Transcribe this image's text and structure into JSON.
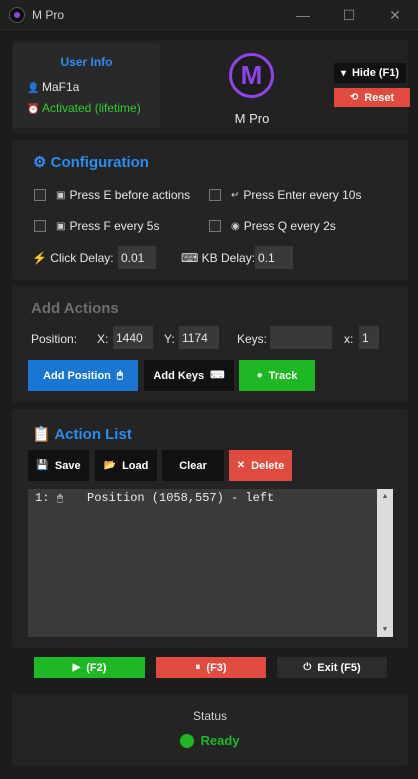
{
  "window": {
    "title": "M Pro",
    "minimize_glyph": "—",
    "maximize_glyph": "☐",
    "close_glyph": "✕"
  },
  "user_info": {
    "title": "User Info",
    "username": "MaF1a",
    "user_glyph": "👤",
    "status": "Activated (lifetime)",
    "status_glyph": "⏰",
    "status_color": "#2fcf2f"
  },
  "logo": {
    "letter": "M",
    "label": "M Pro",
    "color": "#8e44e8"
  },
  "header_buttons": {
    "hide_label": "Hide (F1)",
    "hide_glyph": "▾",
    "reset_label": "Reset",
    "reset_glyph": "⟲"
  },
  "configuration": {
    "title": "Configuration",
    "title_glyph": "⚙",
    "options": [
      {
        "label": "Press E before actions",
        "glyph": "▣",
        "checked": false
      },
      {
        "label": "Press Enter every 10s",
        "glyph": "↵",
        "checked": false
      },
      {
        "label": "Press F every 5s",
        "glyph": "▣",
        "checked": false
      },
      {
        "label": "Press Q every 2s",
        "glyph": "◉",
        "checked": false
      }
    ],
    "click_delay_label": "Click Delay:",
    "click_delay_glyph": "⚡",
    "click_delay_value": "0.01",
    "kb_delay_label": "KB Delay:",
    "kb_delay_glyph": "⌨",
    "kb_delay_value": "0.1"
  },
  "add_actions": {
    "title": "Add Actions",
    "position_label": "Position:",
    "x_label": "X:",
    "x_value": "1440",
    "y_label": "Y:",
    "y_value": "1174",
    "keys_label": "Keys:",
    "keys_value": "",
    "repeat_label": "x:",
    "repeat_value": "1",
    "add_position_label": "Add Position",
    "add_position_glyph": "🖱",
    "add_keys_label": "Add Keys",
    "add_keys_glyph": "⌨",
    "track_label": "Track",
    "track_glyph": "●"
  },
  "action_list": {
    "title": "Action List",
    "title_glyph": "📋",
    "save_label": "Save",
    "save_glyph": "💾",
    "load_label": "Load",
    "load_glyph": "📂",
    "clear_label": "Clear",
    "delete_label": "Delete",
    "delete_glyph": "✕",
    "items": [
      {
        "index": "1:",
        "glyph": "🖱",
        "text": "Position (1058,557) - left"
      }
    ]
  },
  "controls": {
    "start_label": "(F2)",
    "start_glyph": "▶",
    "pause_label": "(F3)",
    "pause_glyph": "⏸",
    "exit_label": "Exit (F5)",
    "exit_glyph": "⏻"
  },
  "status": {
    "title": "Status",
    "value": "Ready",
    "color": "#1db823"
  }
}
